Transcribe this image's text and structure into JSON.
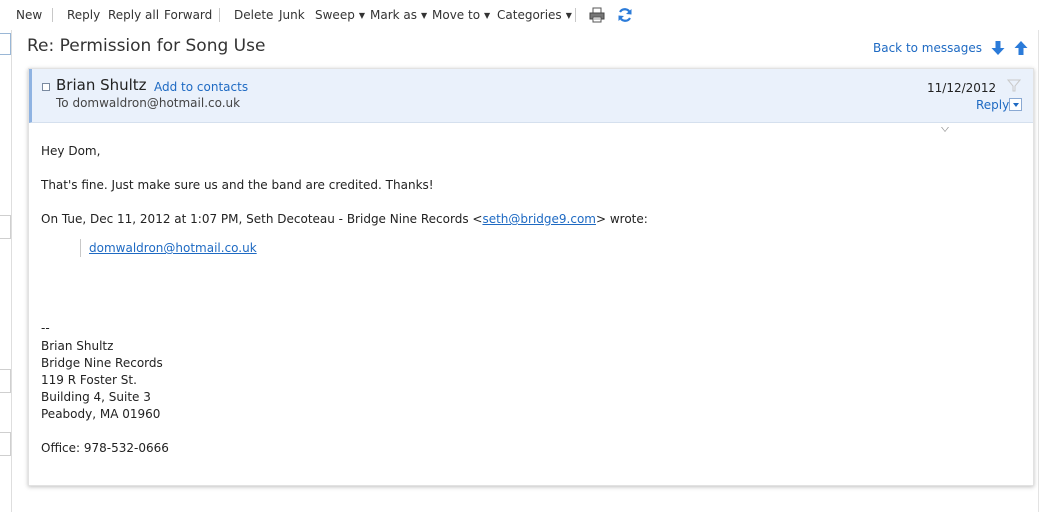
{
  "toolbar": {
    "new": "New",
    "reply": "Reply",
    "reply_all": "Reply all",
    "forward": "Forward",
    "delete": "Delete",
    "junk": "Junk",
    "sweep": "Sweep",
    "mark_as": "Mark as",
    "move_to": "Move to",
    "categories": "Categories",
    "print_icon": "printer-icon",
    "refresh_icon": "refresh-icon"
  },
  "message": {
    "subject": "Re: Permission for Song Use",
    "back_link": "Back to messages",
    "sender": "Brian Shultz",
    "add_contacts": "Add to contacts",
    "to": "To domwaldron@hotmail.co.uk",
    "date": "11/12/2012",
    "reply": "Reply"
  },
  "body": {
    "greeting": "Hey Dom,",
    "line1": "That's fine. Just make sure us and the band are credited. Thanks!",
    "quote_intro_before": "On Tue, Dec 11, 2012 at 1:07 PM, Seth Decoteau - Bridge Nine Records <",
    "quote_email": "seth@bridge9.com",
    "quote_intro_after": "> wrote:",
    "quoted_link": "domwaldron@hotmail.co.uk",
    "sig_dash": "--",
    "sig_name": "Brian Shultz",
    "sig_company": "Bridge Nine Records",
    "sig_address1": "119 R Foster St.",
    "sig_address2": "Building 4, Suite 3",
    "sig_city": "Peabody, MA 01960",
    "sig_office": "Office: 978-532-0666"
  },
  "colors": {
    "link": "#1e6ac3",
    "header_bg": "#eaf1fb",
    "arrow": "#2b7bd9"
  }
}
